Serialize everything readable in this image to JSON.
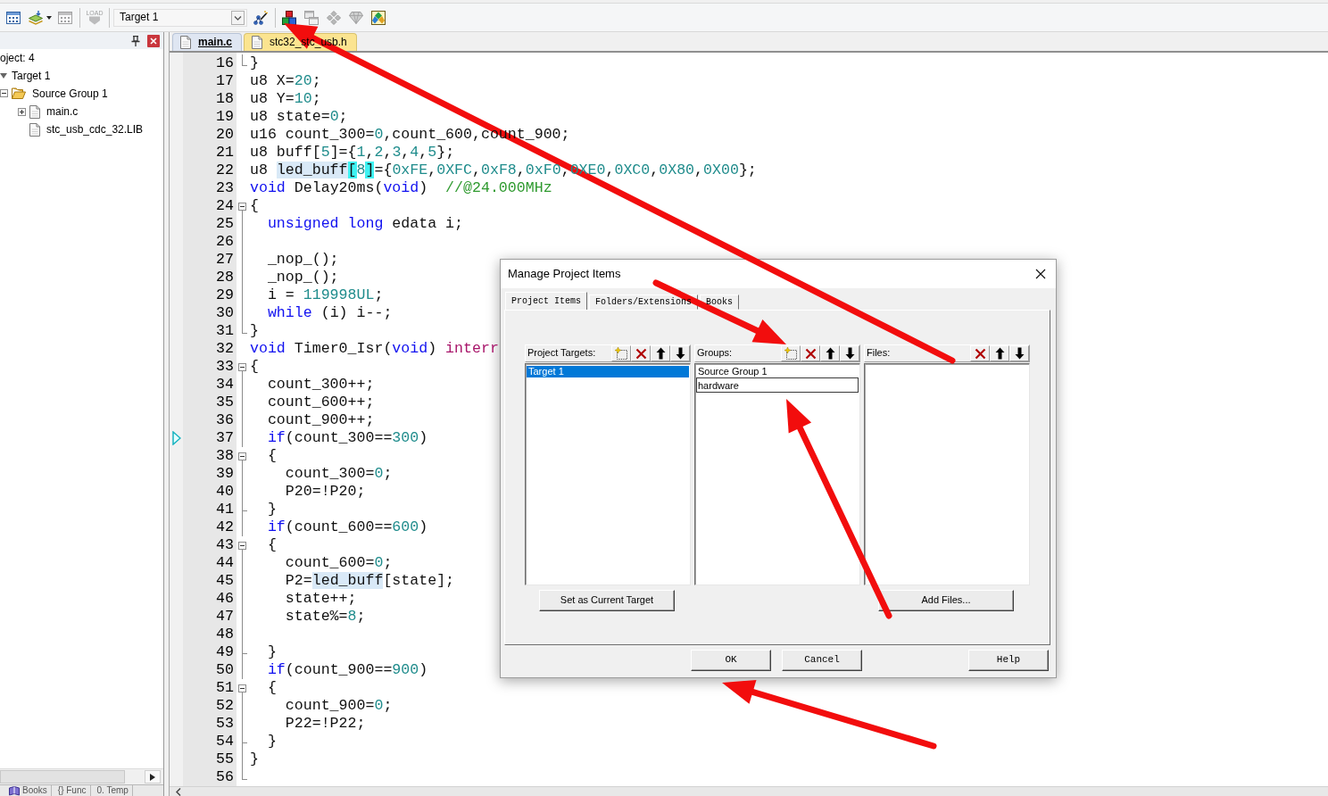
{
  "toolbar": {
    "tools": [
      {
        "disabled": false
      },
      {
        "disabled": false
      },
      {
        "disabled": true
      },
      {
        "label": "LOAD",
        "disabled": true
      }
    ],
    "target": "Target 1",
    "project_tools": [
      {
        "disabled": false
      },
      {
        "disabled": false
      },
      {
        "disabled": true
      },
      {
        "disabled": true
      },
      {
        "disabled": true
      },
      {
        "disabled": false
      }
    ]
  },
  "project_panel": {
    "tree": [
      {
        "text": "oject: 4",
        "children": [
          {
            "text": "Target 1",
            "kind": "target",
            "expanded": true,
            "children": [
              {
                "text": "Source Group 1",
                "kind": "group",
                "expanded": true,
                "children": [
                  {
                    "text": "main.c",
                    "kind": "file",
                    "expanded": false
                  },
                  {
                    "text": "stc_usb_cdc_32.LIB",
                    "kind": "file"
                  }
                ]
              }
            ]
          }
        ]
      }
    ],
    "tabs": [
      {
        "label": "Books",
        "selected": false
      },
      {
        "label": "{} Func",
        "selected": false
      },
      {
        "label": "0. Temp",
        "selected": false
      }
    ]
  },
  "editor": {
    "tabs": [
      {
        "label": "main.c",
        "selected": true
      },
      {
        "label": "stc32_stc_usb.h",
        "selected": false
      }
    ],
    "lines": [
      {
        "number": "16",
        "kind": "end",
        "marker": false,
        "text": "}"
      },
      {
        "number": "17",
        "kind": "plain",
        "marker": false,
        "tokens": [
          {
            "text": "u8 X=",
            "kind": "plain"
          },
          {
            "text": "20",
            "kind": "number"
          },
          {
            "text": ";",
            "kind": "plain"
          }
        ]
      },
      {
        "number": "18",
        "kind": "plain",
        "marker": false,
        "tokens": [
          {
            "text": "u8 Y=",
            "kind": "plain"
          },
          {
            "text": "10",
            "kind": "number"
          },
          {
            "text": ";",
            "kind": "plain"
          }
        ]
      },
      {
        "number": "19",
        "kind": "plain",
        "marker": false,
        "tokens": [
          {
            "text": "u8 state=",
            "kind": "plain"
          },
          {
            "text": "0",
            "kind": "number"
          },
          {
            "text": ";",
            "kind": "plain"
          }
        ]
      },
      {
        "number": "20",
        "kind": "plain",
        "marker": false,
        "tokens": [
          {
            "text": "u16 count_300=",
            "kind": "plain"
          },
          {
            "text": "0",
            "kind": "number"
          },
          {
            "text": ",count_600,count_900;",
            "kind": "plain"
          }
        ]
      },
      {
        "number": "21",
        "kind": "plain",
        "marker": false,
        "tokens": [
          {
            "text": "u8 buff[",
            "kind": "plain"
          },
          {
            "text": "5",
            "kind": "number"
          },
          {
            "text": "]={",
            "kind": "plain"
          },
          {
            "text": "1",
            "kind": "number"
          },
          {
            "text": ",",
            "kind": "plain"
          },
          {
            "text": "2",
            "kind": "number"
          },
          {
            "text": ",",
            "kind": "plain"
          },
          {
            "text": "3",
            "kind": "number"
          },
          {
            "text": ",",
            "kind": "plain"
          },
          {
            "text": "4",
            "kind": "number"
          },
          {
            "text": ",",
            "kind": "plain"
          },
          {
            "text": "5",
            "kind": "number"
          },
          {
            "text": "};",
            "kind": "plain"
          }
        ]
      },
      {
        "number": "22",
        "kind": "plain",
        "marker": false,
        "tokens": [
          {
            "text": "u8 ",
            "kind": "plain"
          },
          {
            "text": "led_buff",
            "kind": "highlight"
          },
          {
            "text": "[",
            "kind": "match"
          },
          {
            "text": "8",
            "kind": "number"
          },
          {
            "text": "]",
            "kind": "match"
          },
          {
            "text": "={",
            "kind": "plain"
          },
          {
            "text": "0xFE",
            "kind": "number"
          },
          {
            "text": ",",
            "kind": "plain"
          },
          {
            "text": "0XFC",
            "kind": "number"
          },
          {
            "text": ",",
            "kind": "plain"
          },
          {
            "text": "0xF8",
            "kind": "number"
          },
          {
            "text": ",",
            "kind": "plain"
          },
          {
            "text": "0xF0",
            "kind": "number"
          },
          {
            "text": ",",
            "kind": "plain"
          },
          {
            "text": "0XE0",
            "kind": "number"
          },
          {
            "text": ",",
            "kind": "plain"
          },
          {
            "text": "0XC0",
            "kind": "number"
          },
          {
            "text": ",",
            "kind": "plain"
          },
          {
            "text": "0X80",
            "kind": "number"
          },
          {
            "text": ",",
            "kind": "plain"
          },
          {
            "text": "0X00",
            "kind": "number"
          },
          {
            "text": "};",
            "kind": "plain"
          }
        ]
      },
      {
        "number": "23",
        "kind": "plain",
        "marker": false,
        "tokens": [
          {
            "text": "void",
            "kind": "keyword"
          },
          {
            "text": " Delay20ms(",
            "kind": "plain"
          },
          {
            "text": "void",
            "kind": "keyword"
          },
          {
            "text": ")  ",
            "kind": "plain"
          },
          {
            "text": "//@24.000MHz",
            "kind": "comment"
          }
        ]
      },
      {
        "number": "24",
        "kind": "start",
        "marker": false,
        "text": "{"
      },
      {
        "number": "25",
        "kind": "inside",
        "marker": false,
        "tokens": [
          {
            "text": "  unsigned long",
            "kind": "keyword"
          },
          {
            "text": " edata i;",
            "kind": "plain"
          }
        ]
      },
      {
        "number": "26",
        "kind": "inside",
        "marker": false
      },
      {
        "number": "27",
        "kind": "inside",
        "marker": false,
        "text": "  _nop_();"
      },
      {
        "number": "28",
        "kind": "inside",
        "marker": false,
        "text": "  _nop_();"
      },
      {
        "number": "29",
        "kind": "inside",
        "marker": false,
        "tokens": [
          {
            "text": "  i = ",
            "kind": "plain"
          },
          {
            "text": "119998UL",
            "kind": "number"
          },
          {
            "text": ";",
            "kind": "plain"
          }
        ]
      },
      {
        "number": "30",
        "kind": "inside",
        "marker": false,
        "tokens": [
          {
            "text": "  while",
            "kind": "keyword"
          },
          {
            "text": " (i) i--;",
            "kind": "plain"
          }
        ]
      },
      {
        "number": "31",
        "kind": "end",
        "marker": false,
        "text": "}"
      },
      {
        "number": "32",
        "kind": "plain",
        "marker": false,
        "tokens": [
          {
            "text": "void",
            "kind": "keyword"
          },
          {
            "text": " Timer0_Isr(",
            "kind": "plain"
          },
          {
            "text": "void",
            "kind": "keyword"
          },
          {
            "text": ") ",
            "kind": "plain"
          },
          {
            "text": "interr",
            "kind": "special"
          }
        ]
      },
      {
        "number": "33",
        "kind": "start",
        "marker": false,
        "text": "{"
      },
      {
        "number": "34",
        "kind": "inside",
        "marker": false,
        "text": "  count_300++;"
      },
      {
        "number": "35",
        "kind": "inside",
        "marker": false,
        "text": "  count_600++;"
      },
      {
        "number": "36",
        "kind": "inside",
        "marker": false,
        "text": "  count_900++;"
      },
      {
        "number": "37",
        "kind": "inside",
        "marker": true,
        "tokens": [
          {
            "text": "  if",
            "kind": "keyword"
          },
          {
            "text": "(count_300==",
            "kind": "plain"
          },
          {
            "text": "300",
            "kind": "number"
          },
          {
            "text": ")",
            "kind": "plain"
          }
        ]
      },
      {
        "number": "38",
        "kind": "start",
        "marker": false,
        "text": "  {"
      },
      {
        "number": "39",
        "kind": "inside",
        "marker": false,
        "tokens": [
          {
            "text": "    count_300=",
            "kind": "plain"
          },
          {
            "text": "0",
            "kind": "number"
          },
          {
            "text": ";",
            "kind": "plain"
          }
        ]
      },
      {
        "number": "40",
        "kind": "inside",
        "marker": false,
        "text": "    P20=!P20;"
      },
      {
        "number": "41",
        "kind": "branch",
        "marker": false,
        "text": "  }"
      },
      {
        "number": "42",
        "kind": "inside",
        "marker": false,
        "tokens": [
          {
            "text": "  if",
            "kind": "keyword"
          },
          {
            "text": "(count_600==",
            "kind": "plain"
          },
          {
            "text": "600",
            "kind": "number"
          },
          {
            "text": ")",
            "kind": "plain"
          }
        ]
      },
      {
        "number": "43",
        "kind": "start",
        "marker": false,
        "text": "  {"
      },
      {
        "number": "44",
        "kind": "inside",
        "marker": false,
        "tokens": [
          {
            "text": "    count_600=",
            "kind": "plain"
          },
          {
            "text": "0",
            "kind": "number"
          },
          {
            "text": ";",
            "kind": "plain"
          }
        ]
      },
      {
        "number": "45",
        "kind": "inside",
        "marker": false,
        "tokens": [
          {
            "text": "    P2=",
            "kind": "plain"
          },
          {
            "text": "led_buff",
            "kind": "highlight"
          },
          {
            "text": "[state];",
            "kind": "plain"
          }
        ]
      },
      {
        "number": "46",
        "kind": "inside",
        "marker": false,
        "text": "    state++;"
      },
      {
        "number": "47",
        "kind": "inside",
        "marker": false,
        "tokens": [
          {
            "text": "    state%=",
            "kind": "plain"
          },
          {
            "text": "8",
            "kind": "number"
          },
          {
            "text": ";",
            "kind": "plain"
          }
        ]
      },
      {
        "number": "48",
        "kind": "inside",
        "marker": false
      },
      {
        "number": "49",
        "kind": "branch",
        "marker": false,
        "text": "  }"
      },
      {
        "number": "50",
        "kind": "inside",
        "marker": false,
        "tokens": [
          {
            "text": "  if",
            "kind": "keyword"
          },
          {
            "text": "(count_900==",
            "kind": "plain"
          },
          {
            "text": "900",
            "kind": "number"
          },
          {
            "text": ")",
            "kind": "plain"
          }
        ]
      },
      {
        "number": "51",
        "kind": "start",
        "marker": false,
        "text": "  {"
      },
      {
        "number": "52",
        "kind": "inside",
        "marker": false,
        "tokens": [
          {
            "text": "    count_900=",
            "kind": "plain"
          },
          {
            "text": "0",
            "kind": "number"
          },
          {
            "text": ";",
            "kind": "plain"
          }
        ]
      },
      {
        "number": "53",
        "kind": "inside",
        "marker": false,
        "text": "    P22=!P22;"
      },
      {
        "number": "54",
        "kind": "branch",
        "marker": false,
        "text": "  }"
      },
      {
        "number": "55",
        "kind": "inside",
        "marker": false,
        "text": "}"
      },
      {
        "number": "56",
        "kind": "end",
        "marker": false
      }
    ]
  },
  "dialog": {
    "title": "Manage Project Items",
    "tabs": [
      {
        "label": "Project Items",
        "selected": true
      },
      {
        "label": "Folders/Extensions",
        "selected": false
      },
      {
        "label": "Books",
        "selected": false
      }
    ],
    "panels": [
      {
        "label": "Project Targets:",
        "actions": [
          {
            "kind": "new"
          },
          {
            "kind": "delete"
          },
          {
            "kind": "up"
          },
          {
            "kind": "down"
          }
        ],
        "items": [
          {
            "text": "Target 1",
            "selected": true,
            "editing": false
          }
        ],
        "button": "Set as Current Target"
      },
      {
        "label": "Groups:",
        "actions": [
          {
            "kind": "new"
          },
          {
            "kind": "delete"
          },
          {
            "kind": "up"
          },
          {
            "kind": "down"
          }
        ],
        "items": [
          {
            "text": "Source Group 1",
            "selected": false,
            "editing": false
          },
          {
            "text": "hardware",
            "selected": false,
            "editing": true
          }
        ]
      },
      {
        "label": "Files:",
        "actions": [
          {
            "kind": "delete"
          },
          {
            "kind": "up"
          },
          {
            "kind": "down"
          }
        ],
        "button": "Add Files..."
      }
    ],
    "buttons": [
      "OK",
      "Cancel",
      "Help"
    ]
  }
}
